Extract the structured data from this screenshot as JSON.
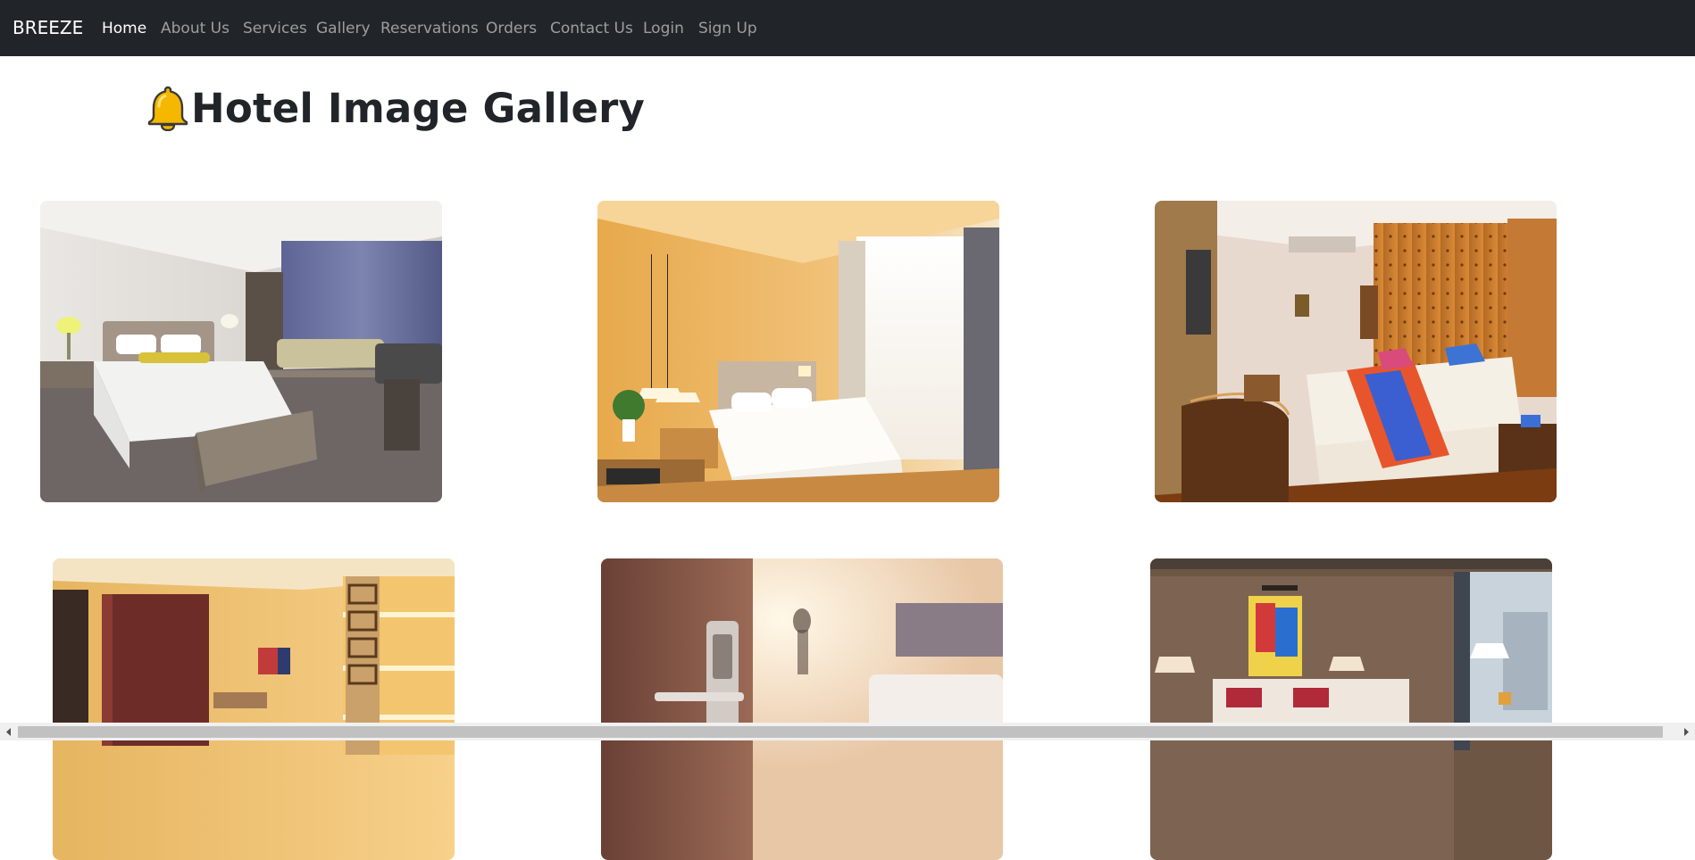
{
  "navbar": {
    "brand": "BREEZE",
    "items": [
      {
        "label": "Home",
        "active": true
      },
      {
        "label": "About Us",
        "active": false
      },
      {
        "label": "Services",
        "active": false
      },
      {
        "label": "Gallery",
        "active": false
      },
      {
        "label": "Reservations",
        "active": false
      },
      {
        "label": "Orders",
        "active": false
      },
      {
        "label": "Contact Us",
        "active": false
      },
      {
        "label": "Login",
        "active": false
      },
      {
        "label": "Sign Up",
        "active": false
      }
    ]
  },
  "page": {
    "title_icon": "bell-icon",
    "title": "Hotel Image Gallery"
  },
  "gallery": {
    "photos": [
      {
        "subject": "white hotel bedroom with sofa and desk"
      },
      {
        "subject": "warm wood-panelled bedroom with pendant lamps"
      },
      {
        "subject": "tufted headboard bedroom with colourful bedspread"
      },
      {
        "subject": "golden lit room with lattice screen"
      },
      {
        "subject": "key-card door lock with sunlit room"
      },
      {
        "subject": "bedroom with red pillows and city window"
      }
    ]
  },
  "colors": {
    "navbar_bg": "#212529",
    "nav_active": "#ffffff",
    "nav_inactive": "rgba(255,255,255,0.55)",
    "title_text": "#212529",
    "bell": "#f5b700"
  }
}
